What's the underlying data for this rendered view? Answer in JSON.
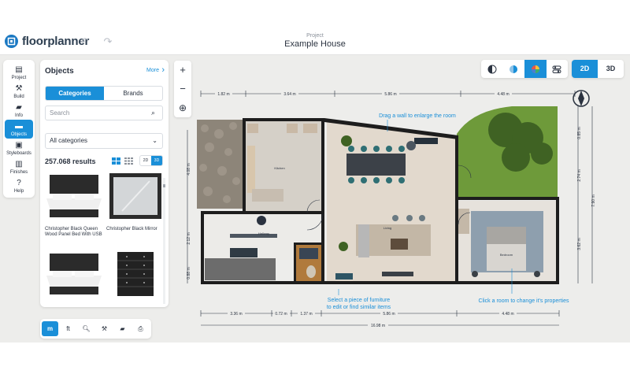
{
  "app": {
    "brand": "floorplanner",
    "project_caption": "Project",
    "project_title": "Example House"
  },
  "colors": {
    "accent": "#1a8fd8",
    "brand": "#1a78c2"
  },
  "rail": [
    {
      "label": "Project",
      "icon": "project-icon"
    },
    {
      "label": "Build",
      "icon": "build-icon"
    },
    {
      "label": "Info",
      "icon": "info-icon"
    },
    {
      "label": "Objects",
      "icon": "objects-icon",
      "active": true
    },
    {
      "label": "Styleboards",
      "icon": "styleboards-icon"
    },
    {
      "label": "Finishes",
      "icon": "finishes-icon"
    },
    {
      "label": "Help",
      "icon": "help-icon"
    }
  ],
  "panel": {
    "title": "Objects",
    "more": "More",
    "tabs": [
      "Categories",
      "Brands"
    ],
    "search_placeholder": "Search",
    "category": "All categories",
    "results": "257.068 results",
    "toggle": [
      "2D",
      "3D"
    ],
    "items": [
      {
        "caption": "Christopher Black Queen Wood Panel Bed With USB"
      },
      {
        "caption": "Christopher Black Mirror"
      },
      {
        "caption": ""
      },
      {
        "caption": ""
      }
    ]
  },
  "zoom": {
    "in": "+",
    "out": "−"
  },
  "view_modes": {
    "options": [
      "2D",
      "3D"
    ],
    "selected": "2D"
  },
  "bottom_toolbar": {
    "units": [
      "m",
      "ft"
    ],
    "selected_unit": "m"
  },
  "plan": {
    "dims_top": [
      "1.82 m",
      "3.64 m",
      "5.86 m",
      "4.48 m"
    ],
    "dims_bottom": [
      "3.36 m",
      "0.72 m",
      "1.37 m",
      "5.86 m",
      "4.48 m"
    ],
    "dim_total": "16.98 m",
    "dims_left": [
      "4.08 m",
      "2.12 m",
      "0.88 m"
    ],
    "dims_right_a": [
      "0.85 m",
      "2.74 m",
      "3.62 m"
    ],
    "dim_right_total": "7.90 m",
    "rooms": {
      "kitchen": "Kitchen",
      "hallway": "Hallway",
      "living": "Living",
      "bedroom": "Bedroom"
    },
    "hints": {
      "drag_wall": "Drag a wall to enlarge the room",
      "select_furniture": "Select a piece of furniture\nto edit or find similar items",
      "click_room": "Click a room to change it's properties"
    }
  }
}
